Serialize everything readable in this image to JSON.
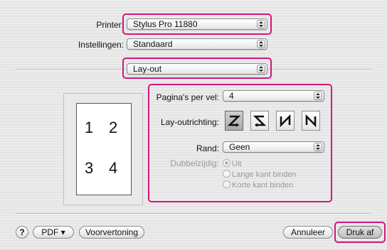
{
  "printer": {
    "label": "Printer:",
    "value": "Stylus Pro 11880"
  },
  "settings": {
    "label": "Instellingen:",
    "value": "Standaard"
  },
  "panel": {
    "value": "Lay-out"
  },
  "pages_per_sheet": {
    "label": "Pagina's per vel:",
    "value": "4"
  },
  "layout_direction": {
    "label": "Lay-outrichting:"
  },
  "border": {
    "label": "Rand:",
    "value": "Geen"
  },
  "duplex": {
    "label": "Dubbelzijdig:",
    "options": [
      "Uit",
      "Lange kant binden",
      "Korte kant binden"
    ],
    "selected": "Uit"
  },
  "preview": {
    "pages": [
      "1",
      "2",
      "3",
      "4"
    ]
  },
  "bottom": {
    "help": "?",
    "pdf": "PDF ▾",
    "preview_button": "Voorvertoning",
    "cancel": "Annuleer",
    "print": "Druk af"
  },
  "colors": {
    "highlight": "#d1177e"
  }
}
